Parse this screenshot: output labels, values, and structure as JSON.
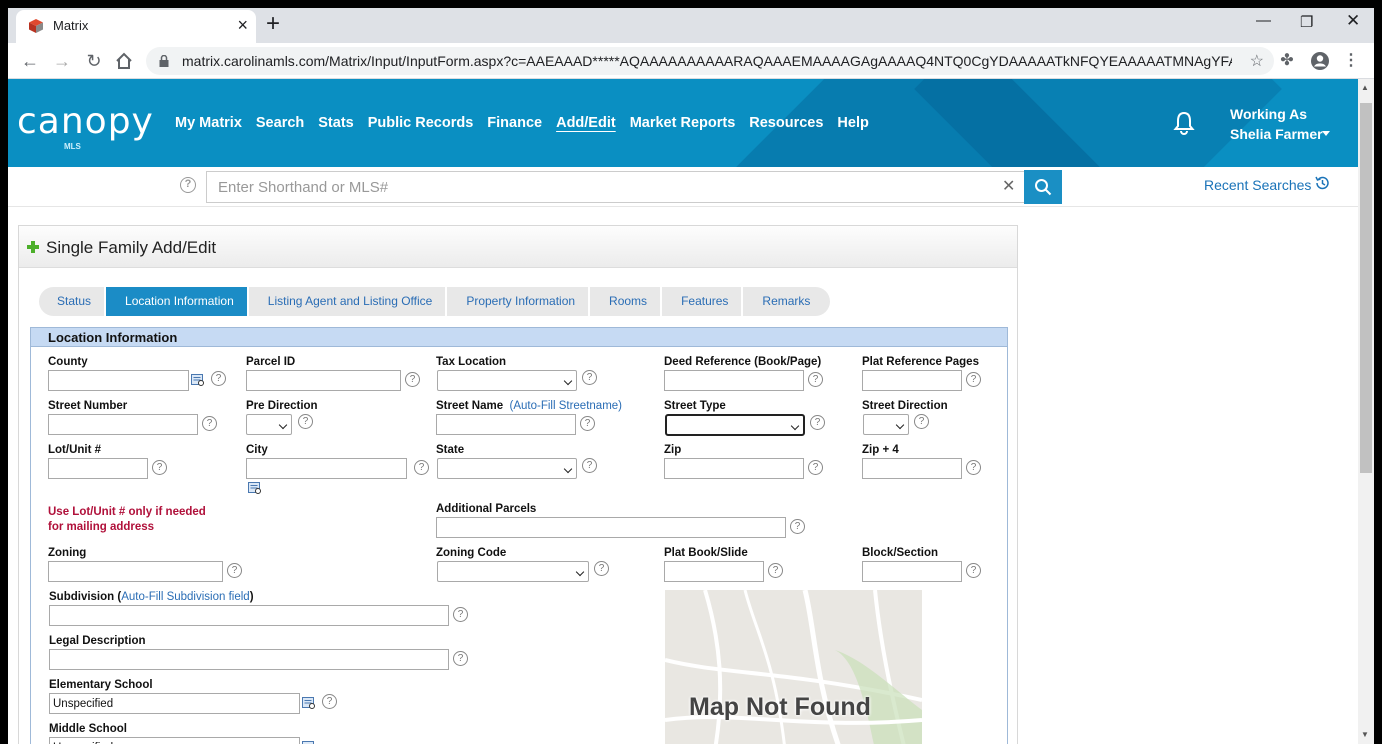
{
  "browser": {
    "tab_title": "Matrix",
    "url": "matrix.carolinamls.com/Matrix/Input/InputForm.aspx?c=AAEAAAD*****AQAAAAAAAAAARAQAAAEMAAAAGAgAAAAQ4NTQ0CgYDAAAAATkNFQYEAAAAATMNAgYFAAA..."
  },
  "header": {
    "logo": "canopy",
    "logo_sub": "MLS",
    "nav": [
      "My Matrix",
      "Search",
      "Stats",
      "Public Records",
      "Finance",
      "Add/Edit",
      "Market Reports",
      "Resources",
      "Help"
    ],
    "active_nav": "Add/Edit",
    "working_as": "Working As",
    "user": "Shelia Farmer"
  },
  "search": {
    "placeholder": "Enter Shorthand or MLS#",
    "recent": "Recent Searches"
  },
  "form": {
    "title": "Single Family Add/Edit",
    "steps": [
      "Status",
      "Location Information",
      "Listing Agent and Listing Office",
      "Property Information",
      "Rooms",
      "Features",
      "Remarks"
    ],
    "active_step": "Location Information",
    "section_title": "Location Information",
    "labels": {
      "county": "County",
      "parcel_id": "Parcel ID",
      "tax_location": "Tax Location",
      "deed_reference": "Deed Reference (Book/Page)",
      "plat_reference": "Plat Reference Pages",
      "street_number": "Street Number",
      "pre_direction": "Pre Direction",
      "street_name": "Street Name",
      "street_name_link": "(Auto-Fill Streetname)",
      "street_type": "Street Type",
      "street_direction": "Street Direction",
      "lot_unit": "Lot/Unit #",
      "city": "City",
      "state": "State",
      "zip": "Zip",
      "zip4": "Zip + 4",
      "additional_parcels": "Additional Parcels",
      "zoning": "Zoning",
      "zoning_code": "Zoning Code",
      "plat_book": "Plat Book/Slide",
      "block_section": "Block/Section",
      "subdivision": "Subdivision (",
      "subdivision_link": "Auto-Fill Subdivision field",
      "subdivision_close": ")",
      "legal_description": "Legal Description",
      "elementary_school": "Elementary School",
      "middle_school": "Middle School"
    },
    "warning_line1": "Use Lot/Unit # only if needed",
    "warning_line2": "for mailing address",
    "values": {
      "elementary_school": "Unspecified",
      "middle_school": "Unspecified"
    },
    "map_text": "Map Not Found",
    "help_glyph": "?"
  },
  "colors": {
    "header_bg": "#0a8fc2",
    "active_step": "#1b8cc6",
    "section_head": "#c6daf3",
    "warning": "#b0103a"
  }
}
